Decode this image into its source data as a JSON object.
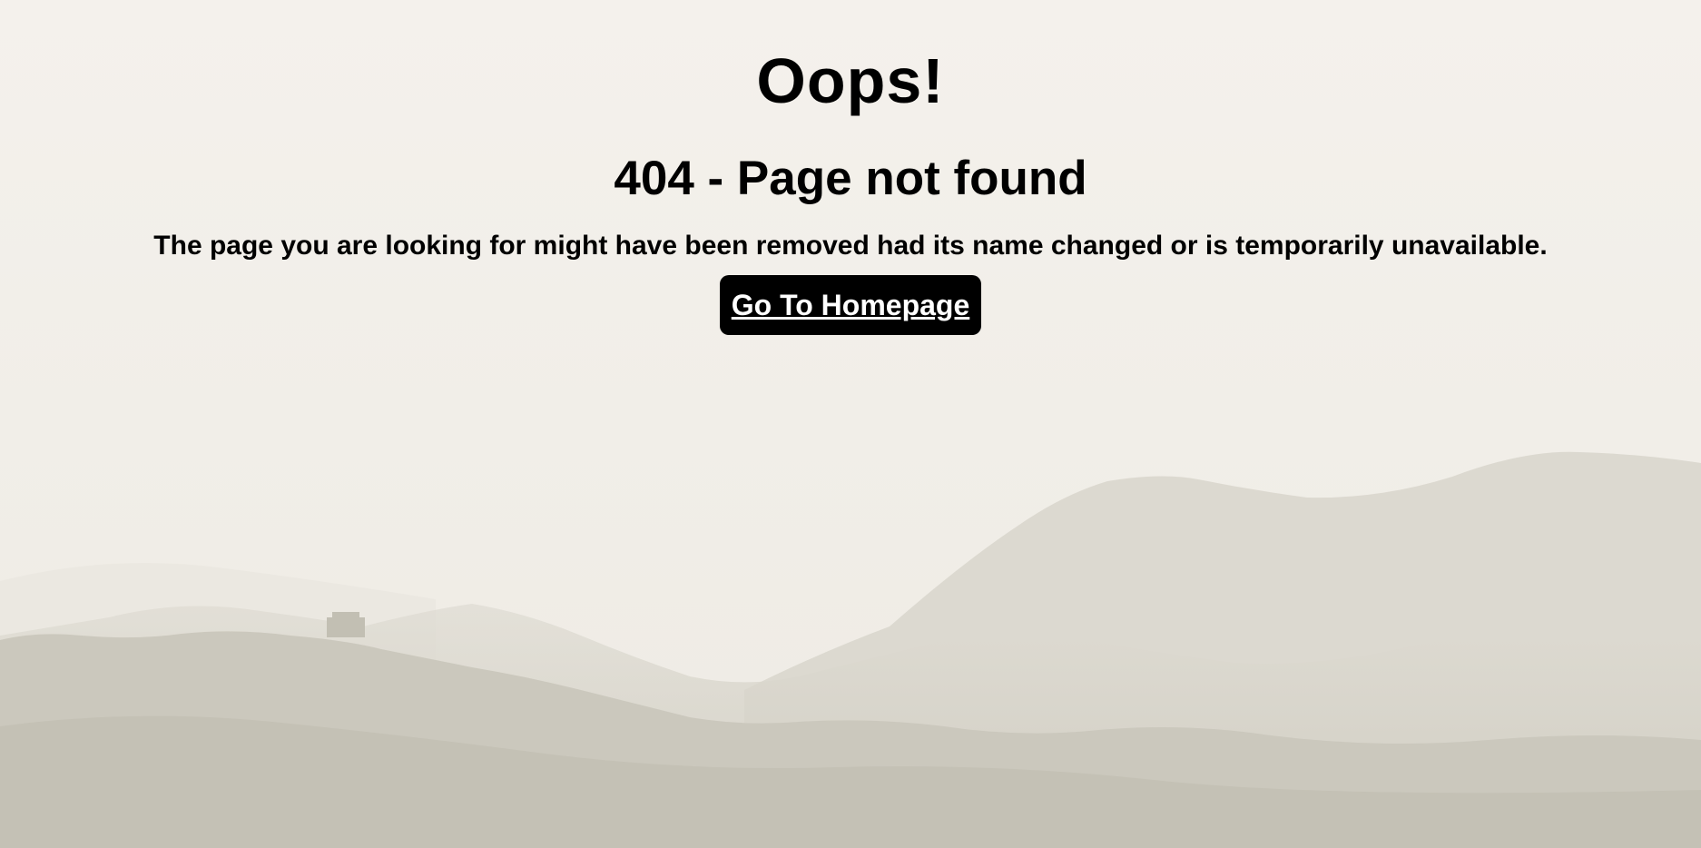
{
  "page": {
    "title": "Oops!",
    "subtitle": "404 - Page not found",
    "message": "The page you are looking for might have been removed had its name changed or is temporarily unavailable.",
    "home_button_label": "Go To Homepage"
  },
  "colors": {
    "background": "#f4f1ec",
    "text": "#000000",
    "button_bg": "#000000",
    "button_text": "#ffffff"
  },
  "background_image": "misty-mountains-with-great-wall"
}
